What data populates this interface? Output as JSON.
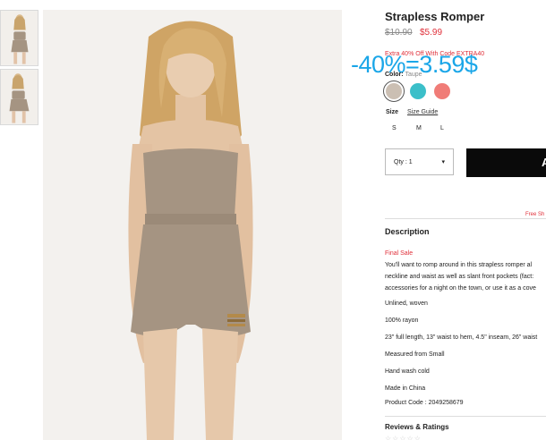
{
  "thumbnails": [
    {
      "icon": "romper-front-photo"
    },
    {
      "icon": "romper-side-photo"
    }
  ],
  "hero_image": {
    "icon": "model-wearing-romper-photo"
  },
  "product": {
    "title": "Strapless Romper",
    "price_old": "$10.90",
    "price_new": "$5.99",
    "promo": "Extra 40% Off With Code EXTRA40",
    "overlay": "-40%=3.59$"
  },
  "color": {
    "label": "Color:",
    "selected": "Taupe",
    "swatches": [
      {
        "name": "taupe",
        "color": "#cbbfb3"
      },
      {
        "name": "teal",
        "color": "#3bbfc9"
      },
      {
        "name": "coral",
        "color": "#f07c77"
      }
    ]
  },
  "size": {
    "label": "Size",
    "guide": "Size Guide",
    "options": [
      "S",
      "M",
      "L"
    ]
  },
  "qty": {
    "label": "Qty : 1",
    "caret": "▾"
  },
  "add_button": {
    "label": "A"
  },
  "free_shipping": "Free Sh",
  "description": {
    "title": "Description",
    "final_sale": "Final Sale",
    "lines": [
      "You'll want to romp around in this strapless romper al",
      "neckline and waist as well as slant front pockets (fact:",
      "accessories for a night on the town, or use it as a cove",
      "Unlined, woven",
      "100% rayon",
      "23\" full length, 13\" waist to hem, 4.5\" inseam, 26\" waist",
      "Measured from Small",
      "Hand wash cold",
      "Made in China",
      "Product Code : 2049258679"
    ]
  },
  "reviews": {
    "title": "Reviews & Ratings",
    "stars": "☆☆☆☆☆"
  },
  "colors": {
    "accent_red": "#e0303a",
    "overlay_blue": "#1aa6e8",
    "button_black": "#0a0a0a"
  }
}
